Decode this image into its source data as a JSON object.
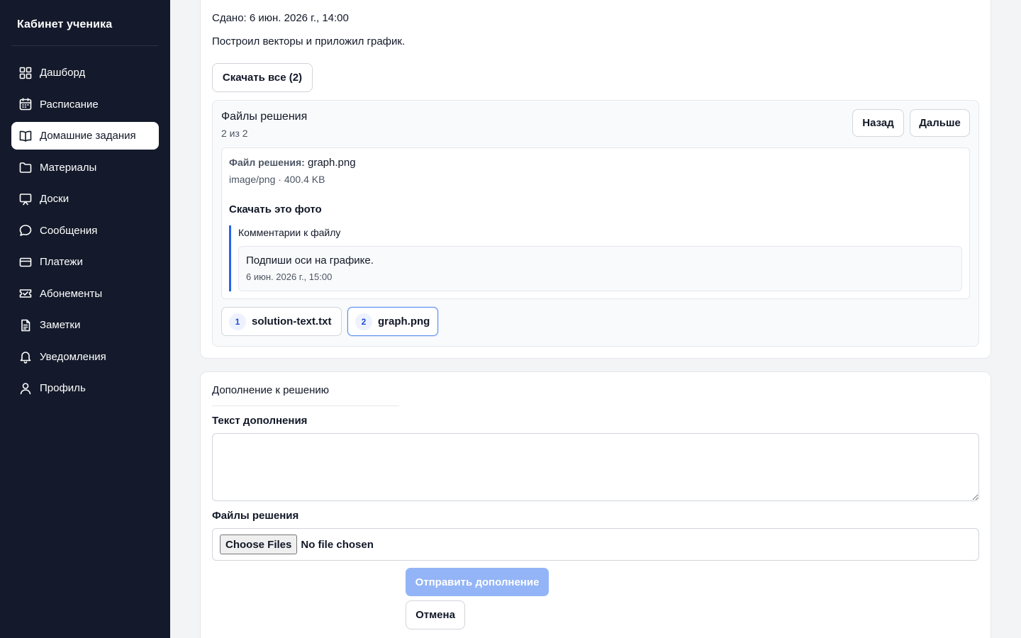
{
  "sidebar": {
    "brand": "Кабинет ученика",
    "items": [
      {
        "label": "Дашборд",
        "icon": "dashboard-icon"
      },
      {
        "label": "Расписание",
        "icon": "calendar-icon"
      },
      {
        "label": "Домашние задания",
        "icon": "book-icon",
        "active": true
      },
      {
        "label": "Материалы",
        "icon": "folder-icon"
      },
      {
        "label": "Доски",
        "icon": "board-icon"
      },
      {
        "label": "Сообщения",
        "icon": "chat-icon"
      },
      {
        "label": "Платежи",
        "icon": "card-icon"
      },
      {
        "label": "Абонементы",
        "icon": "ticket-icon"
      },
      {
        "label": "Заметки",
        "icon": "notes-icon"
      },
      {
        "label": "Уведомления",
        "icon": "bell-icon"
      },
      {
        "label": "Профиль",
        "icon": "user-icon"
      }
    ]
  },
  "submission": {
    "submitted": "Сдано: 6 июн. 2026 г., 14:00",
    "text": "Построил векторы и приложил график.",
    "download_all": "Скачать все (2)"
  },
  "files": {
    "title": "Файлы решения",
    "counter": "2 из 2",
    "prev": "Назад",
    "next": "Дальше",
    "current": {
      "label": "Файл решения:",
      "name": "graph.png",
      "meta": "image/png · 400.4 KB",
      "download": "Скачать это фото",
      "comments_title": "Комментарии к файлу",
      "comments": [
        {
          "text": "Подпиши оси на графике.",
          "date": "6 июн. 2026 г., 15:00"
        }
      ]
    },
    "tabs": [
      {
        "num": "1",
        "name": "solution-text.txt"
      },
      {
        "num": "2",
        "name": "graph.png",
        "active": true
      }
    ]
  },
  "addendum": {
    "title": "Дополнение к решению",
    "text_label": "Текст дополнения",
    "text_value": "",
    "files_label": "Файлы решения",
    "choose_files": "Choose Files",
    "no_file": "No file chosen",
    "submit": "Отправить дополнение",
    "cancel": "Отмена"
  },
  "colors": {
    "sidebar_bg": "#141a2b",
    "accent": "#2563eb",
    "submit_disabled": "#93b4f6"
  }
}
